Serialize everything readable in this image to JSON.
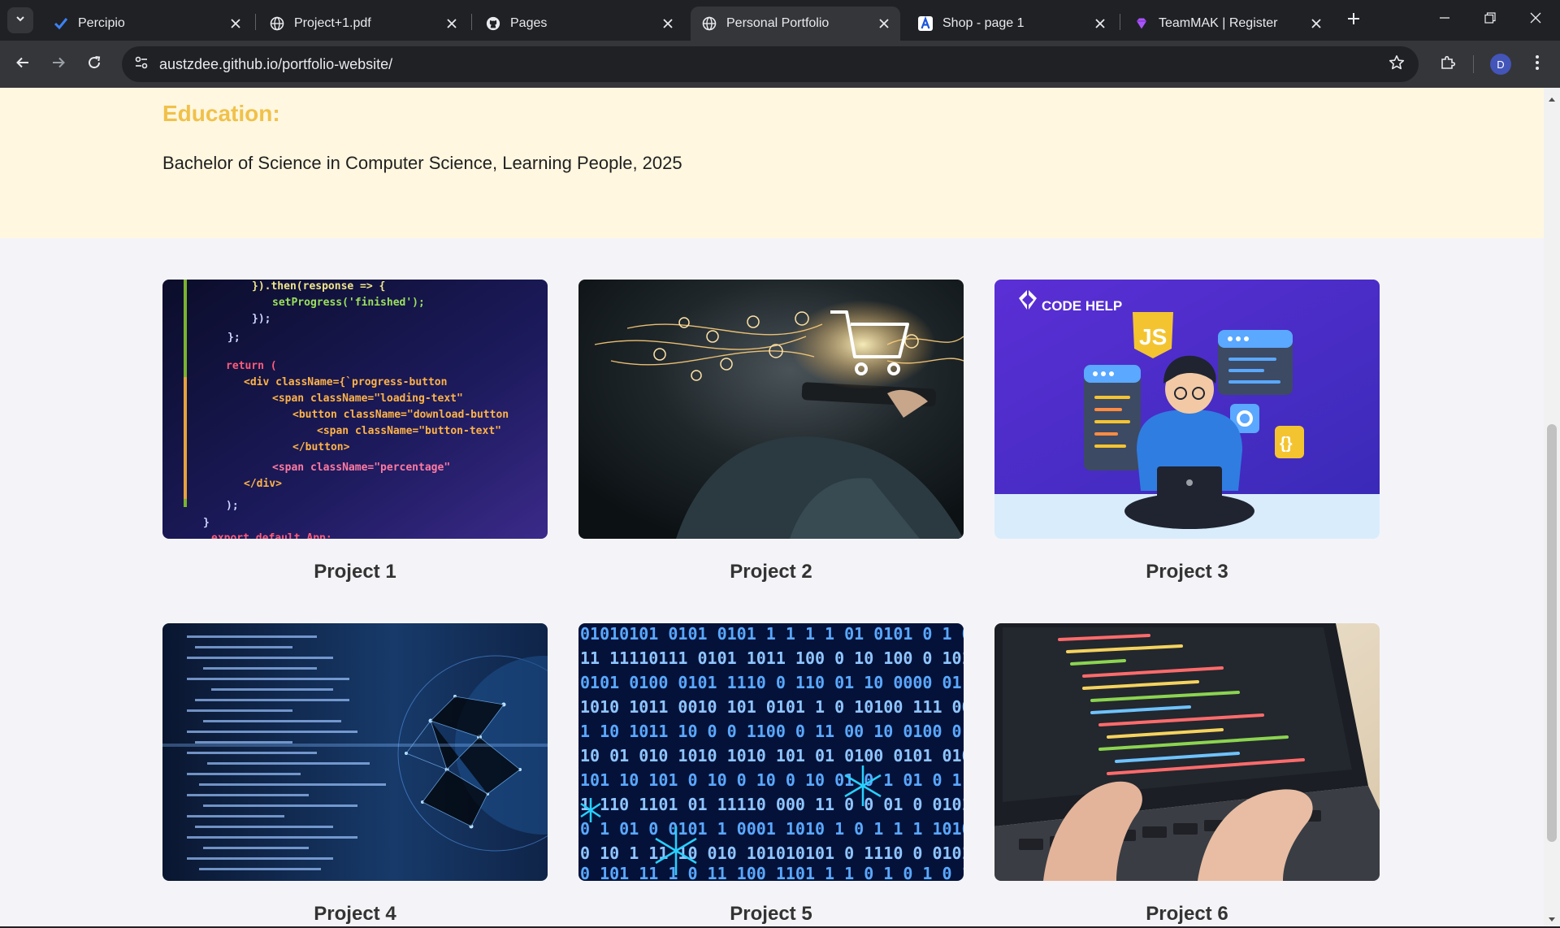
{
  "browser": {
    "tabs": [
      {
        "title": "Percipio",
        "icon": "percipio-icon",
        "active": false
      },
      {
        "title": "Project+1.pdf",
        "icon": "globe-icon",
        "active": false
      },
      {
        "title": "Pages",
        "icon": "github-icon",
        "active": false
      },
      {
        "title": "Personal Portfolio",
        "icon": "globe-icon",
        "active": true
      },
      {
        "title": "Shop - page 1",
        "icon": "letter-a-icon",
        "active": false
      },
      {
        "title": "TeamMAK | Register",
        "icon": "gem-icon",
        "active": false
      }
    ],
    "url": "austzdee.github.io/portfolio-website/",
    "profile_initial": "D",
    "accent_color": "#4355b8"
  },
  "education": {
    "heading": "Education:",
    "degree": "Bachelor of Science in Computer Science, Learning People, 2025",
    "heading_color": "#f0c14b",
    "background_color": "#fff7e0"
  },
  "projects": [
    {
      "title": "Project 1",
      "image": "code-editor-closeup"
    },
    {
      "title": "Project 2",
      "image": "tablet-shopping-cart"
    },
    {
      "title": "Project 3",
      "image": "code-help-js-illustration",
      "image_text": "CODE HELP"
    },
    {
      "title": "Project 4",
      "image": "code-globe-network"
    },
    {
      "title": "Project 5",
      "image": "binary-code-snowflakes"
    },
    {
      "title": "Project 6",
      "image": "laptop-typing-code"
    }
  ]
}
